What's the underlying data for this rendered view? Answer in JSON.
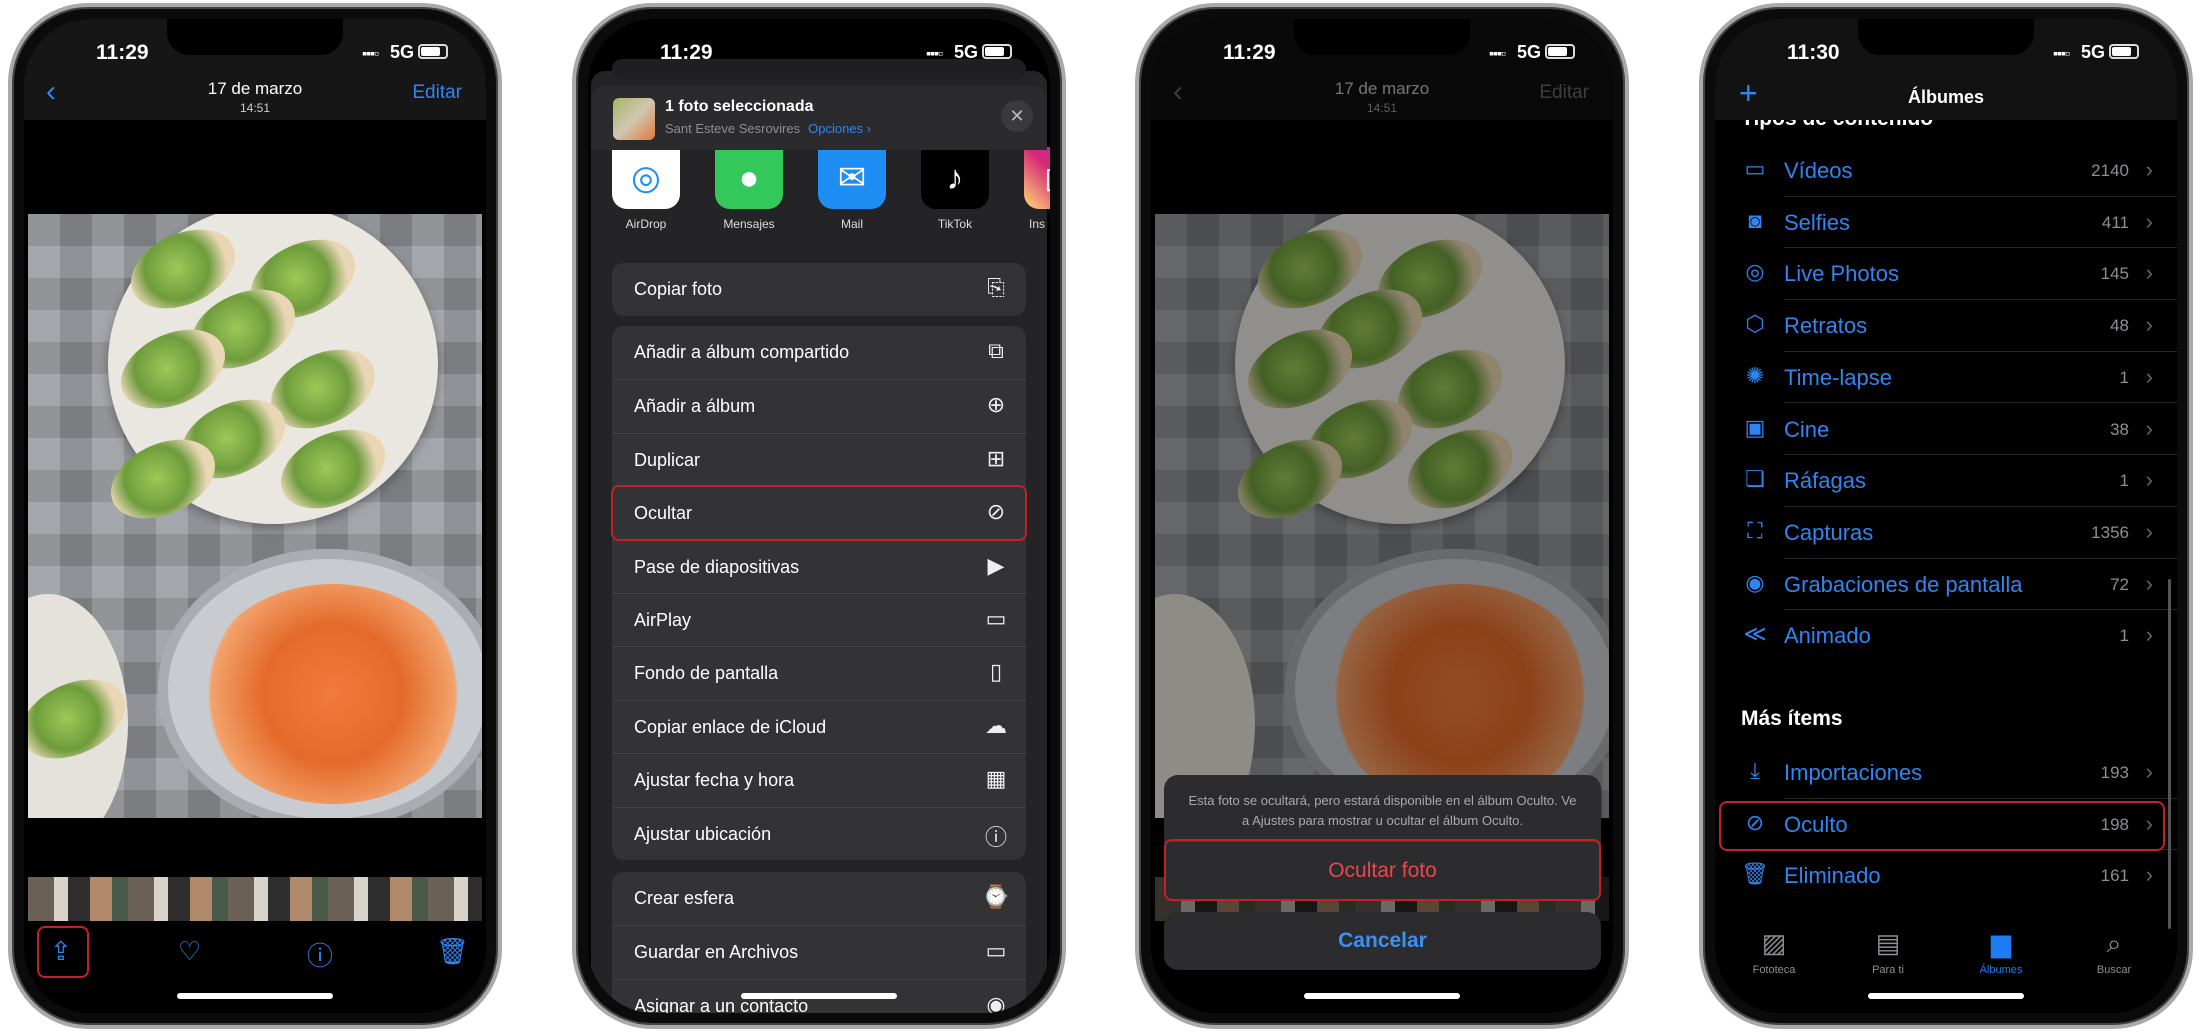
{
  "accent_color": "#2f86f2",
  "highlight_color": "#c3202a",
  "phone1": {
    "time": "11:29",
    "network": "5G",
    "nav": {
      "title": "17 de marzo",
      "subtitle": "14:51",
      "back_icon": "chevron-left-icon",
      "edit": "Editar"
    },
    "toolbar": [
      "share-icon",
      "heart-icon",
      "info-icon",
      "trash-icon"
    ]
  },
  "phone2": {
    "time": "11:29",
    "network": "5G",
    "header": {
      "title": "1 foto seleccionada",
      "location": "Sant Esteve Sesrovires",
      "options": "Opciones ›"
    },
    "apps": [
      {
        "label": "AirDrop",
        "icon": "airdrop-icon",
        "color": "#ffffff"
      },
      {
        "label": "Mensajes",
        "icon": "messages-icon",
        "color": "#34c759"
      },
      {
        "label": "Mail",
        "icon": "mail-icon",
        "color": "#1e8ef5"
      },
      {
        "label": "TikTok",
        "icon": "tiktok-icon",
        "color": "#000000"
      },
      {
        "label": "Ins",
        "icon": "instagram-icon",
        "color": "#d62976"
      }
    ],
    "groups": [
      [
        {
          "label": "Copiar foto",
          "icon": "copy-icon"
        }
      ],
      [
        {
          "label": "Añadir a álbum compartido",
          "icon": "shared-album-icon"
        },
        {
          "label": "Añadir a álbum",
          "icon": "add-album-icon"
        },
        {
          "label": "Duplicar",
          "icon": "duplicate-icon"
        },
        {
          "label": "Ocultar",
          "icon": "eye-slash-icon",
          "highlighted": true
        },
        {
          "label": "Pase de diapositivas",
          "icon": "play-icon"
        },
        {
          "label": "AirPlay",
          "icon": "airplay-icon"
        },
        {
          "label": "Fondo de pantalla",
          "icon": "phone-icon"
        },
        {
          "label": "Copiar enlace de iCloud",
          "icon": "cloud-link-icon"
        },
        {
          "label": "Ajustar fecha y hora",
          "icon": "calendar-icon"
        },
        {
          "label": "Ajustar ubicación",
          "icon": "location-icon"
        }
      ],
      [
        {
          "label": "Crear esfera",
          "icon": "watch-icon"
        },
        {
          "label": "Guardar en Archivos",
          "icon": "folder-icon"
        },
        {
          "label": "Asignar a un contacto",
          "icon": "contact-icon"
        }
      ]
    ]
  },
  "phone3": {
    "time": "11:29",
    "network": "5G",
    "nav": {
      "title": "17 de marzo",
      "subtitle": "14:51",
      "edit": "Editar"
    },
    "action_sheet": {
      "message": "Esta foto se ocultará, pero estará disponible en el álbum Oculto. Ve a Ajustes para mostrar u ocultar el álbum Oculto.",
      "confirm": "Ocultar foto",
      "cancel": "Cancelar"
    }
  },
  "phone4": {
    "time": "11:30",
    "network": "5G",
    "nav": {
      "title": "Álbumes",
      "add_icon": "plus-icon"
    },
    "section1": "Tipos de contenido",
    "media_types": [
      {
        "label": "Vídeos",
        "count": "2140",
        "icon": "video-icon"
      },
      {
        "label": "Selfies",
        "count": "411",
        "icon": "selfie-icon"
      },
      {
        "label": "Live Photos",
        "count": "145",
        "icon": "live-photo-icon"
      },
      {
        "label": "Retratos",
        "count": "48",
        "icon": "cube-icon"
      },
      {
        "label": "Time-lapse",
        "count": "1",
        "icon": "timelapse-icon"
      },
      {
        "label": "Cine",
        "count": "38",
        "icon": "cinema-icon"
      },
      {
        "label": "Ráfagas",
        "count": "1",
        "icon": "burst-icon"
      },
      {
        "label": "Capturas",
        "count": "1356",
        "icon": "screenshot-icon"
      },
      {
        "label": "Grabaciones de pantalla",
        "count": "72",
        "icon": "record-icon"
      },
      {
        "label": "Animado",
        "count": "1",
        "icon": "animated-icon"
      }
    ],
    "section2": "Más ítems",
    "more_items": [
      {
        "label": "Importaciones",
        "count": "193",
        "icon": "import-icon"
      },
      {
        "label": "Oculto",
        "count": "198",
        "icon": "eye-slash-icon",
        "highlighted": true
      },
      {
        "label": "Eliminado",
        "count": "161",
        "icon": "trash-icon"
      }
    ],
    "tabs": [
      {
        "label": "Fototeca",
        "icon": "photos-icon"
      },
      {
        "label": "Para ti",
        "icon": "for-you-icon"
      },
      {
        "label": "Álbumes",
        "icon": "albums-icon",
        "active": true
      },
      {
        "label": "Buscar",
        "icon": "search-icon"
      }
    ]
  }
}
